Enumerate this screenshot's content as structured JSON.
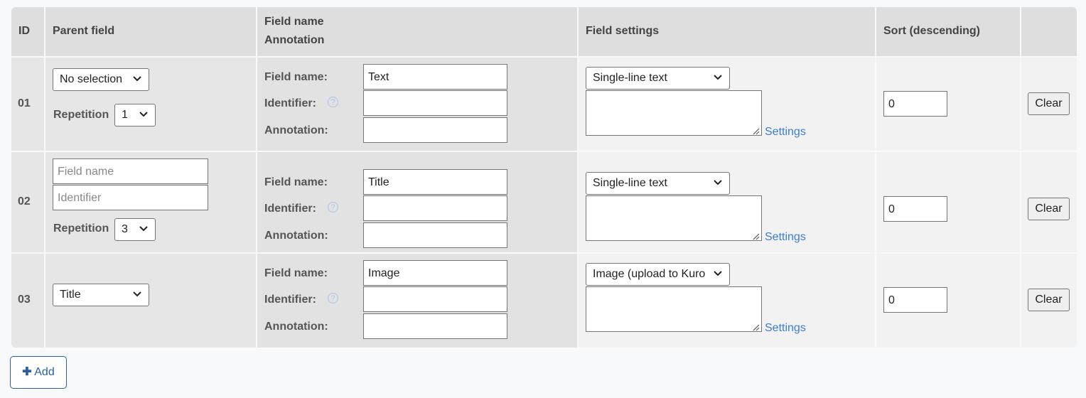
{
  "headers": {
    "id": "ID",
    "parent": "Parent field",
    "field_line1": "Field name",
    "field_line2": "Annotation",
    "settings": "Field settings",
    "sort": "Sort (descending)"
  },
  "labels": {
    "field_name": "Field name:",
    "identifier": "Identifier:",
    "annotation": "Annotation:",
    "repetition": "Repetition",
    "settings_link": "Settings",
    "clear": "Clear",
    "help": "?"
  },
  "rows": [
    {
      "id": "01",
      "parent_select": "No selection",
      "repetition": "1",
      "field_name": "Text",
      "identifier": "",
      "annotation": "",
      "type": "Single-line text",
      "sort": "0"
    },
    {
      "id": "02",
      "parent_field_name_placeholder": "Field name",
      "parent_identifier_placeholder": "Identifier",
      "repetition": "3",
      "field_name": "Title",
      "identifier": "",
      "annotation": "",
      "type": "Single-line text",
      "sort": "0"
    },
    {
      "id": "03",
      "parent_select": "Title",
      "field_name": "Image",
      "identifier": "",
      "annotation": "",
      "type": "Image (upload to Kuro",
      "sort": "0"
    }
  ],
  "add_button": {
    "icon": "plus-icon",
    "label": "Add"
  }
}
